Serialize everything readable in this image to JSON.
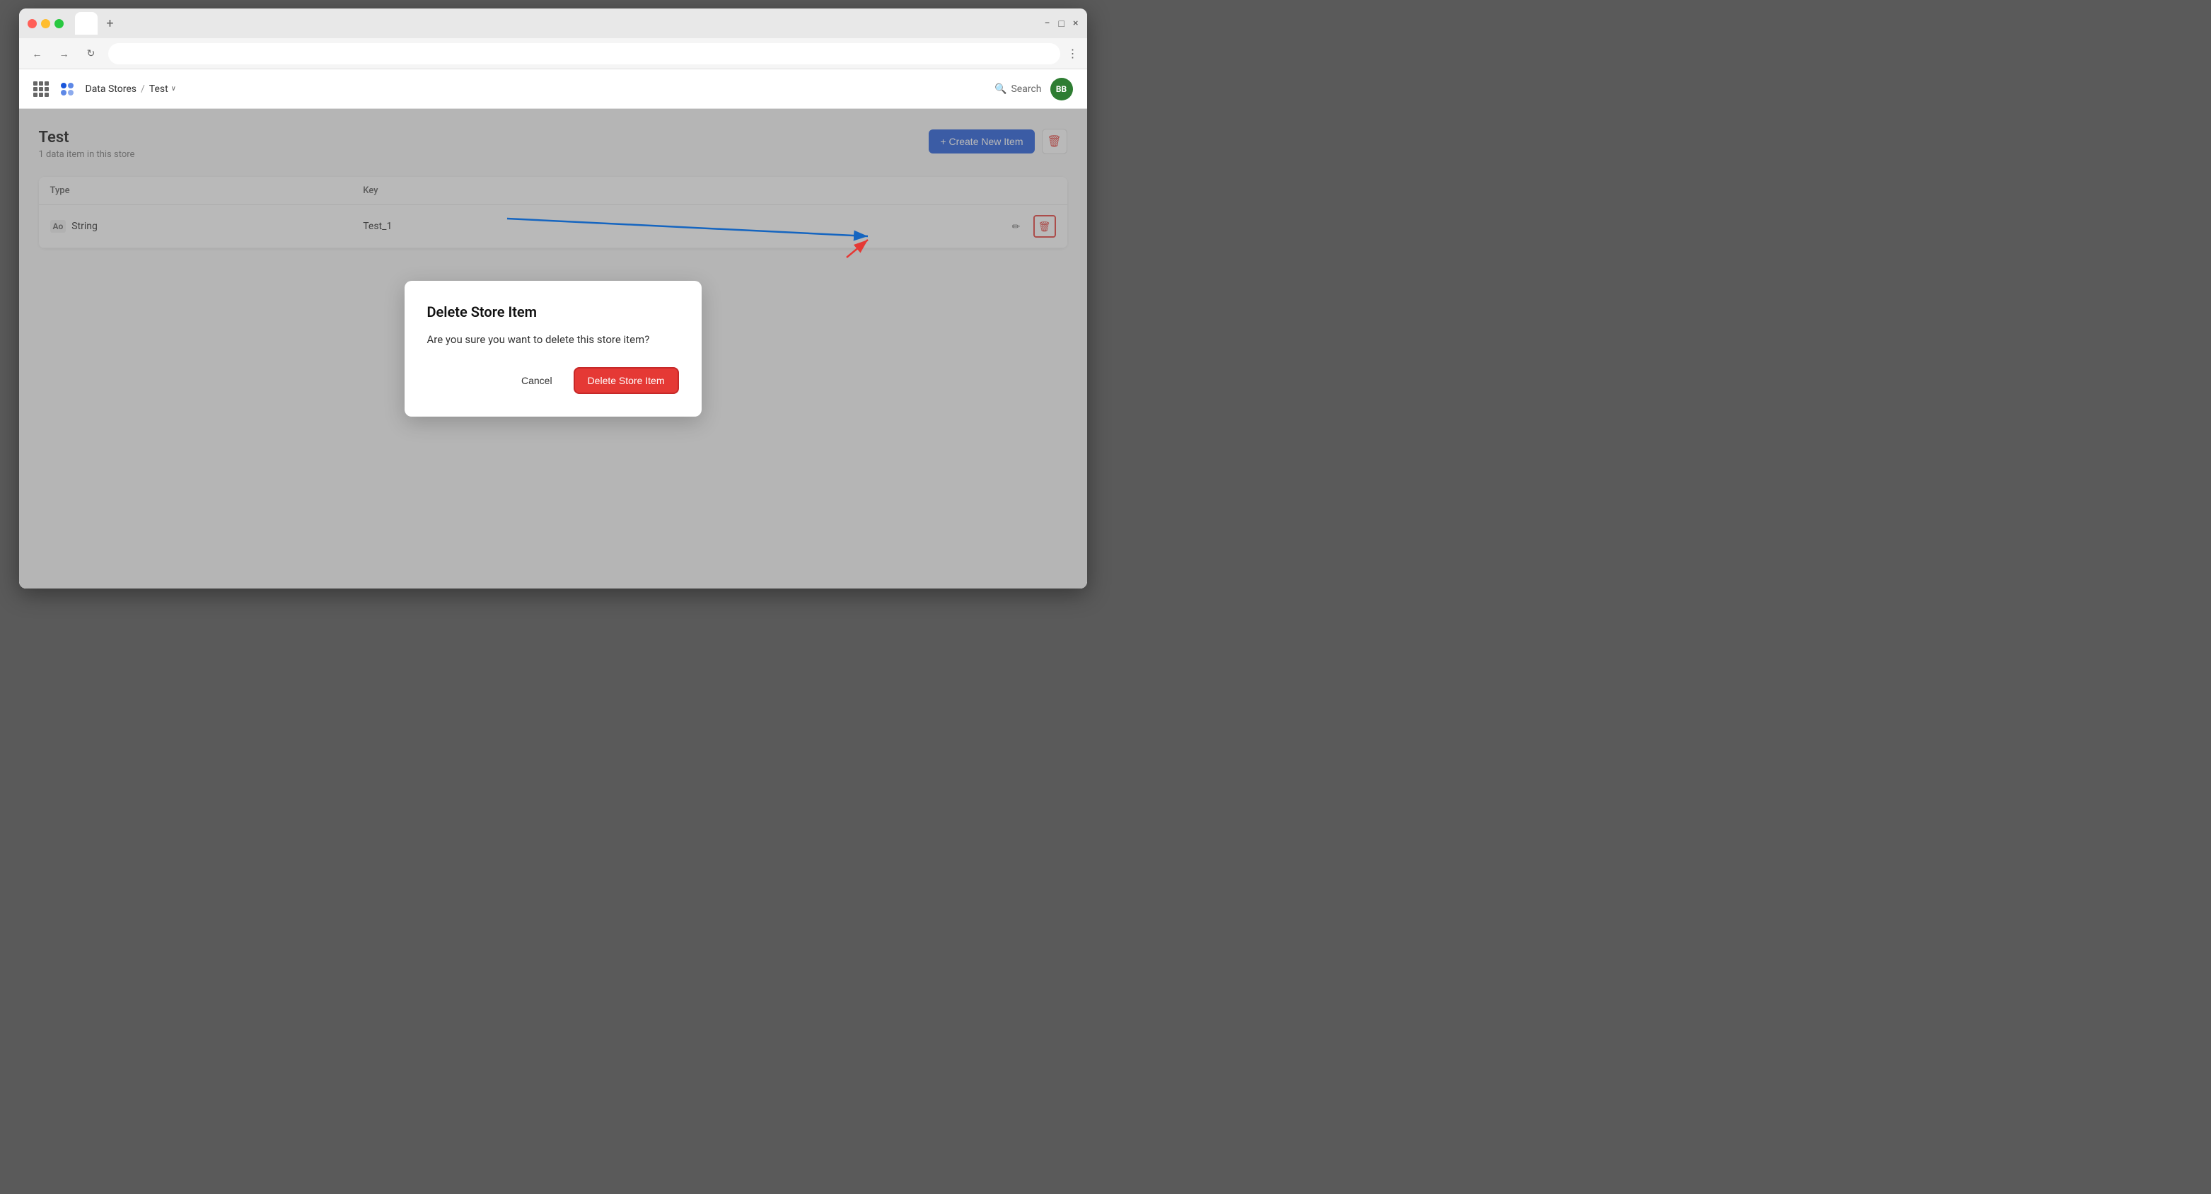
{
  "browser": {
    "tab_label": "",
    "tab_add": "+",
    "address": "",
    "nav": {
      "back": "←",
      "forward": "→",
      "reload": "↻"
    },
    "menu_dots": "⋮",
    "window_controls": {
      "close": "×",
      "minimize": "−",
      "maximize": "□"
    }
  },
  "header": {
    "breadcrumb": {
      "data_stores": "Data Stores",
      "separator": "/",
      "current": "Test",
      "chevron": "∨"
    },
    "search_label": "Search",
    "avatar_initials": "BB"
  },
  "page": {
    "title": "Test",
    "subtitle": "1 data item in this store",
    "create_btn_label": "+ Create New Item",
    "table": {
      "columns": [
        "Type",
        "Key"
      ],
      "rows": [
        {
          "type_icon": "Ao",
          "type": "String",
          "key": "Test_1"
        }
      ]
    }
  },
  "modal": {
    "title": "Delete Store Item",
    "message": "Are you sure you want to delete this store item?",
    "cancel_label": "Cancel",
    "confirm_label": "Delete Store Item"
  },
  "colors": {
    "primary": "#1a56db",
    "danger": "#e53935",
    "avatar_bg": "#2e7d32"
  }
}
